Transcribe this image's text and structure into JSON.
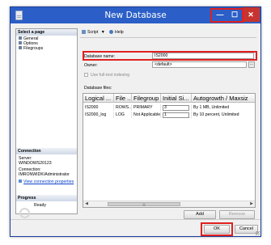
{
  "window": {
    "title": "New Database",
    "min_symbol": "—",
    "max_symbol": "☐",
    "close_symbol": "✕"
  },
  "sidebar": {
    "select_page_header": "Select a page",
    "pages": [
      "General",
      "Options",
      "Filegroups"
    ],
    "connection_header": "Connection",
    "server_label": "Server:",
    "server_value": "WINDOWS20123",
    "connection_label": "Connection:",
    "connection_value": "IMRONWIDK\\Administrator",
    "view_props_link": "View connection properties",
    "progress_header": "Progress",
    "progress_status": "Ready"
  },
  "toolbar": {
    "script_label": "Script",
    "help_label": "Help"
  },
  "form": {
    "database_name_label": "Database name:",
    "database_name_value": "IS2000",
    "owner_label": "Owner:",
    "owner_value": "<default>",
    "owner_browse": "...",
    "fulltext_label": "Use full-text indexing",
    "database_files_label": "Database files:"
  },
  "files_table": {
    "columns": [
      "Logical ...",
      "File ...",
      "Filegroup",
      "Initial Si...",
      "Autogrowth / Maxsiz"
    ],
    "rows": [
      [
        "IS2000",
        "ROWS...",
        "PRIMARY",
        "3",
        "By 1 MB, Unlimited"
      ],
      [
        "IS2000_log",
        "LOG",
        "Not Applicable",
        "1",
        "By 10 percent, Unlimited"
      ]
    ],
    "scroll_left": "◀",
    "scroll_right": "▶",
    "scroll_thumb": "|||"
  },
  "buttons": {
    "add": "Add",
    "remove": "Remove",
    "ok": "OK",
    "cancel": "Cancel"
  },
  "colors": {
    "titlebar": "#2b5fc7",
    "highlight": "#e02020",
    "close": "#c73430",
    "link": "#0b40c8"
  }
}
